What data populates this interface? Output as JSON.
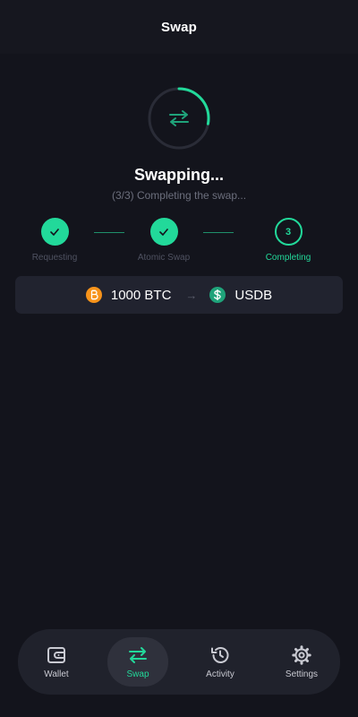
{
  "header": {
    "title": "Swap"
  },
  "status": {
    "title": "Swapping...",
    "subtitle": "(3/3) Completing the swap...",
    "progress_fraction": 0.28
  },
  "steps": [
    {
      "label": "Requesting",
      "state": "done",
      "mark": "✓"
    },
    {
      "label": "Atomic Swap",
      "state": "done",
      "mark": "✓"
    },
    {
      "label": "Completing",
      "state": "active",
      "mark": "3"
    }
  ],
  "pair": {
    "from_amount": "1000 BTC",
    "from_icon": "bitcoin-icon",
    "to_token": "USDB",
    "to_icon": "dollar-coin-icon",
    "arrow": "→"
  },
  "nav": {
    "items": [
      {
        "label": "Wallet",
        "icon": "wallet-icon",
        "active": false
      },
      {
        "label": "Swap",
        "icon": "swap-arrows-icon",
        "active": true
      },
      {
        "label": "Activity",
        "icon": "history-icon",
        "active": false
      },
      {
        "label": "Settings",
        "icon": "gear-icon",
        "active": false
      }
    ]
  },
  "colors": {
    "accent": "#22d99a",
    "background": "#13141c",
    "card": "#21232f",
    "btc": "#f7931a",
    "usd": "#1fa37a"
  }
}
